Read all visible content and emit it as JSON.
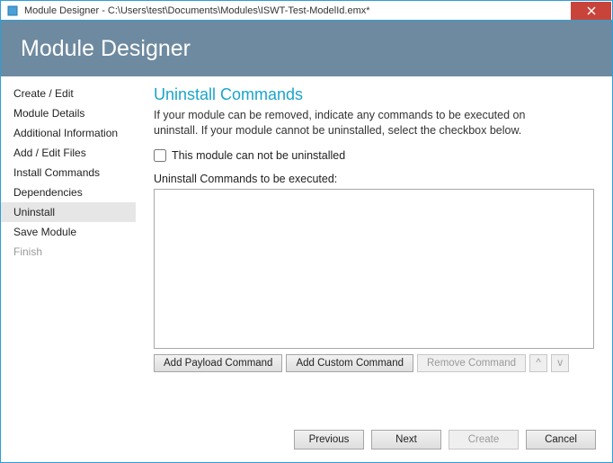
{
  "window": {
    "title": "Module Designer - C:\\Users\\test\\Documents\\Modules\\ISWT-Test-ModelId.emx*",
    "close_icon": "close"
  },
  "header": {
    "title": "Module Designer"
  },
  "sidebar": {
    "items": [
      {
        "label": "Create / Edit",
        "state": "normal"
      },
      {
        "label": "Module Details",
        "state": "normal"
      },
      {
        "label": "Additional Information",
        "state": "normal"
      },
      {
        "label": "Add / Edit Files",
        "state": "normal"
      },
      {
        "label": "Install Commands",
        "state": "normal"
      },
      {
        "label": "Dependencies",
        "state": "normal"
      },
      {
        "label": "Uninstall",
        "state": "selected"
      },
      {
        "label": "Save Module",
        "state": "normal"
      },
      {
        "label": "Finish",
        "state": "disabled"
      }
    ]
  },
  "main": {
    "title": "Uninstall Commands",
    "description": "If your module can be removed, indicate any commands to be executed on uninstall. If your module cannot be uninstalled, select the checkbox below.",
    "cannot_uninstall": {
      "checked": false,
      "label": "This module can not be uninstalled"
    },
    "list_label": "Uninstall Commands to be executed:",
    "commands": [],
    "buttons": {
      "add_payload": "Add Payload Command",
      "add_custom": "Add Custom Command",
      "remove": "Remove Command",
      "move_up": "^",
      "move_down": "v"
    }
  },
  "footer": {
    "previous": "Previous",
    "next": "Next",
    "create": "Create",
    "cancel": "Cancel"
  }
}
